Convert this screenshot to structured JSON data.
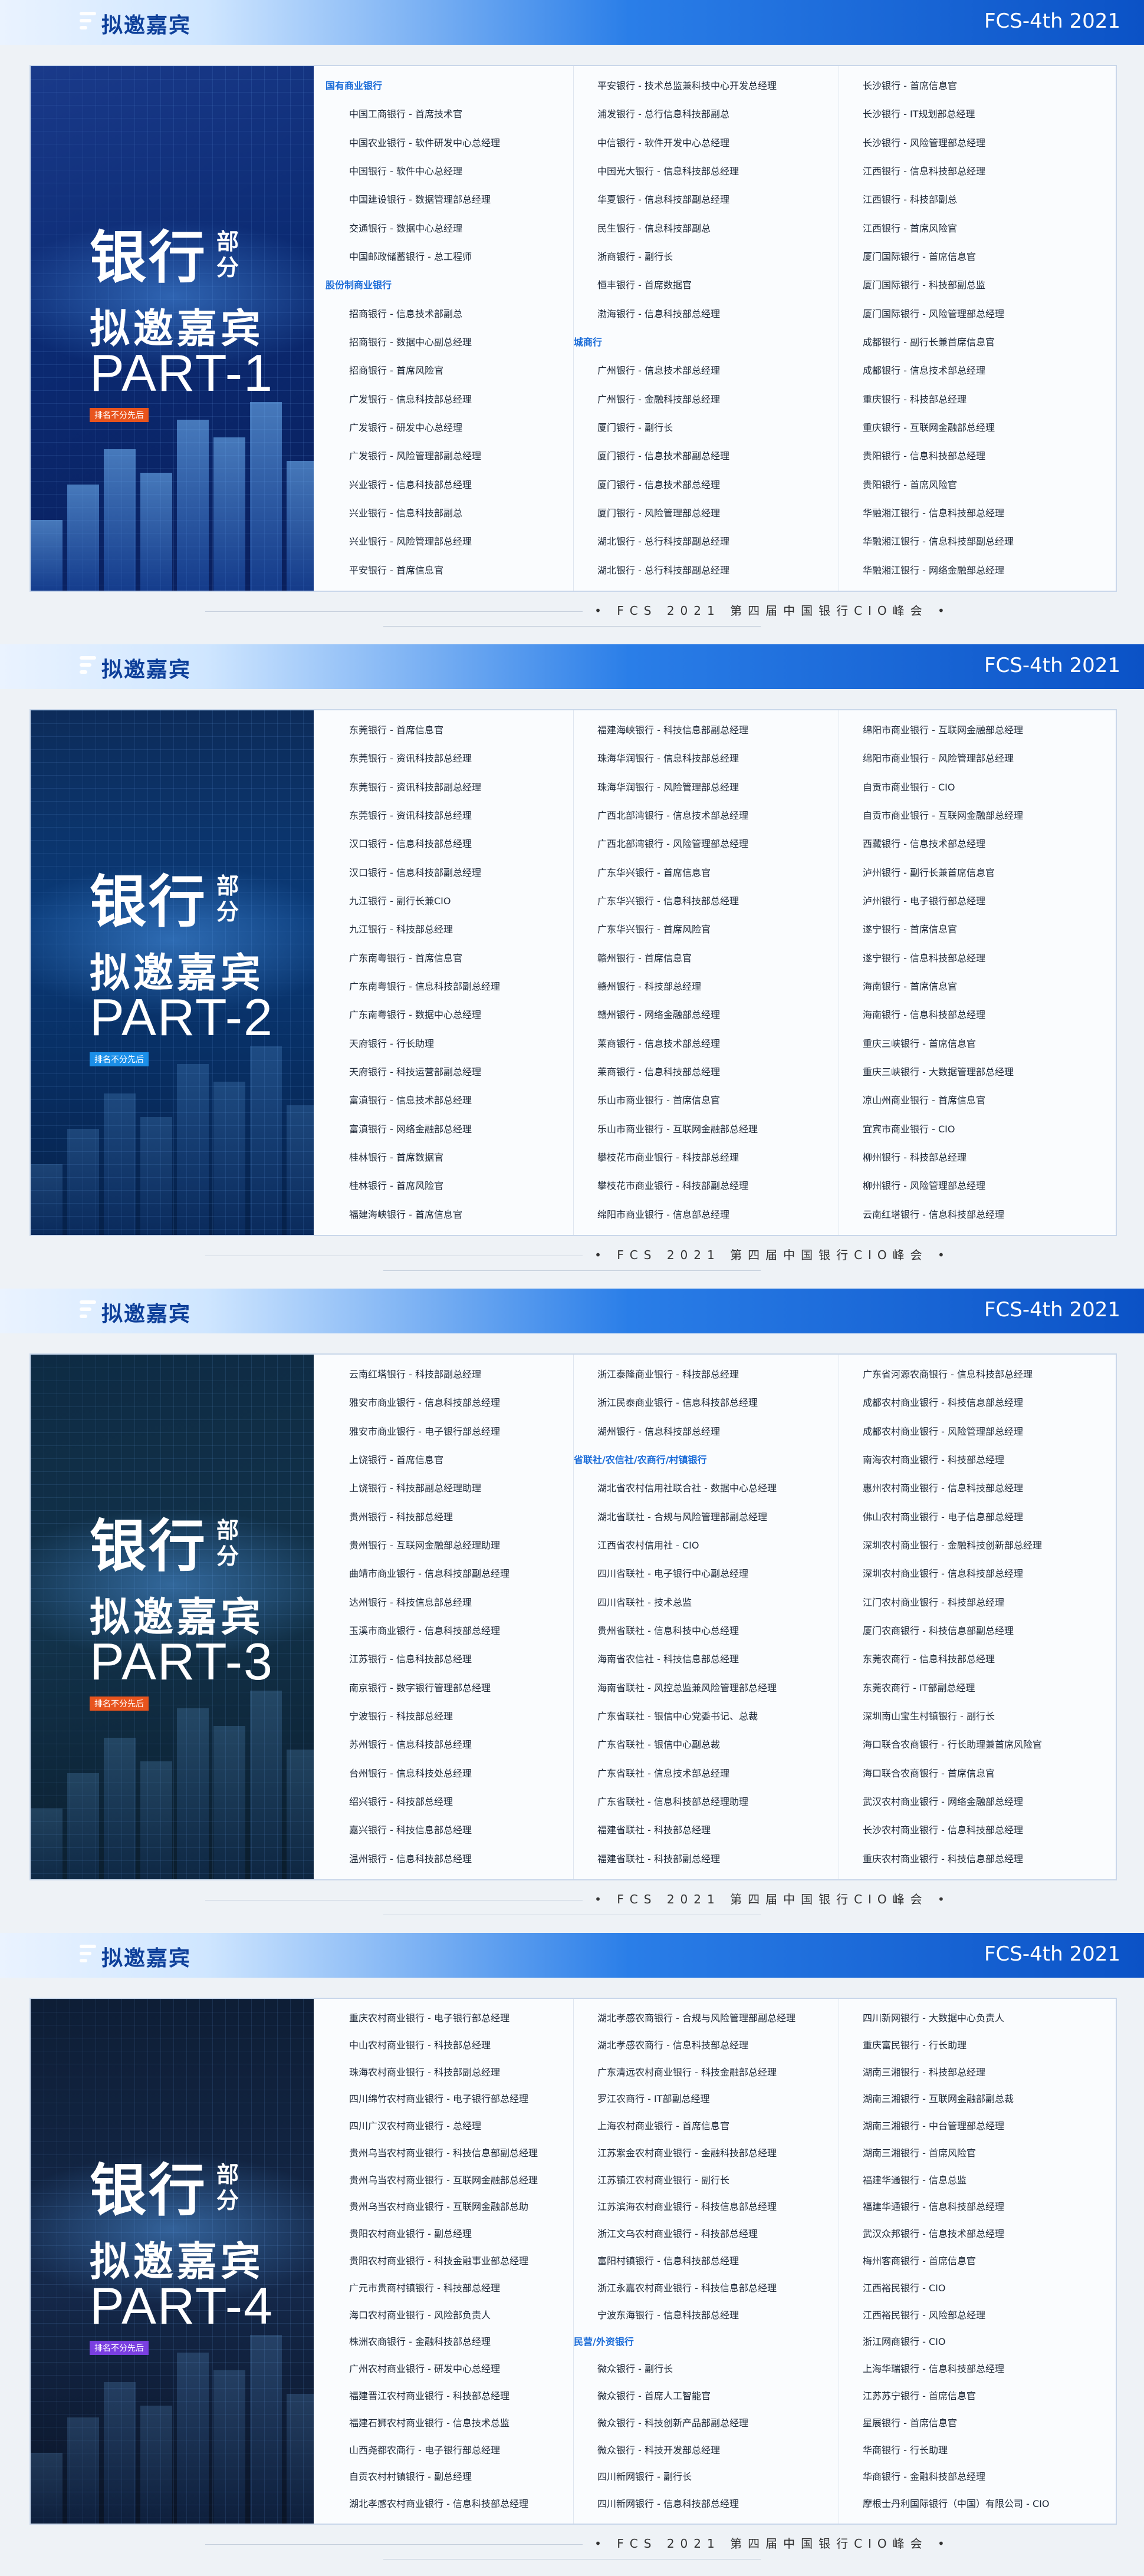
{
  "header": {
    "title": "拟邀嘉宾",
    "code": "FCS-4th 2021"
  },
  "footer": "• FCS 2021 第四届中国银行CIO峰会 •",
  "hero": {
    "big_line1": "银行",
    "small_line1a": "部",
    "small_line1b": "分",
    "big_line2": "拟邀嘉宾",
    "tag": "排名不分先后"
  },
  "sections": [
    {
      "part": "PART-1",
      "col1": [
        {
          "t": "国有商业银行",
          "c": true
        },
        {
          "t": "中国工商银行 - 首席技术官"
        },
        {
          "t": "中国农业银行 - 软件研发中心总经理"
        },
        {
          "t": "中国银行 - 软件中心总经理"
        },
        {
          "t": "中国建设银行 - 数据管理部总经理"
        },
        {
          "t": "交通银行 - 数据中心总经理"
        },
        {
          "t": "中国邮政储蓄银行 - 总工程师"
        },
        {
          "t": "股份制商业银行",
          "c": true
        },
        {
          "t": "招商银行 - 信息技术部副总"
        },
        {
          "t": "招商银行 - 数据中心副总经理"
        },
        {
          "t": "招商银行 - 首席风险官"
        },
        {
          "t": "广发银行 - 信息科技部总经理"
        },
        {
          "t": "广发银行 - 研发中心总经理"
        },
        {
          "t": "广发银行 - 风险管理部副总经理"
        },
        {
          "t": "兴业银行 - 信息科技部总经理"
        },
        {
          "t": "兴业银行 - 信息科技部副总"
        },
        {
          "t": "兴业银行 - 风险管理部总经理"
        },
        {
          "t": "平安银行 - 首席信息官"
        }
      ],
      "col2": [
        {
          "t": "平安银行 - 技术总监兼科技中心开发总经理"
        },
        {
          "t": "浦发银行 - 总行信息科技部副总"
        },
        {
          "t": "中信银行 - 软件开发中心总经理"
        },
        {
          "t": "中国光大银行 - 信息科技部总经理"
        },
        {
          "t": "华夏银行 - 信息科技部副总经理"
        },
        {
          "t": "民生银行 - 信息科技部副总"
        },
        {
          "t": "浙商银行 - 副行长"
        },
        {
          "t": "恒丰银行 - 首席数据官"
        },
        {
          "t": "渤海银行 - 信息科技部总经理"
        },
        {
          "t": "城商行",
          "c": true
        },
        {
          "t": "广州银行 - 信息技术部总经理"
        },
        {
          "t": "广州银行 - 金融科技部总经理"
        },
        {
          "t": "厦门银行 - 副行长"
        },
        {
          "t": "厦门银行 - 信息技术部副总经理"
        },
        {
          "t": "厦门银行 - 信息技术部总经理"
        },
        {
          "t": "厦门银行 - 风险管理部总经理"
        },
        {
          "t": "湖北银行 - 总行科技部副总经理"
        },
        {
          "t": "湖北银行 - 总行科技部副总经理"
        }
      ],
      "col3": [
        {
          "t": "长沙银行 - 首席信息官"
        },
        {
          "t": "长沙银行 - IT规划部总经理"
        },
        {
          "t": "长沙银行 - 风险管理部总经理"
        },
        {
          "t": "江西银行 - 信息科技部总经理"
        },
        {
          "t": "江西银行 - 科技部副总"
        },
        {
          "t": "江西银行 - 首席风险官"
        },
        {
          "t": "厦门国际银行 - 首席信息官"
        },
        {
          "t": "厦门国际银行 - 科技部副总监"
        },
        {
          "t": "厦门国际银行 - 风险管理部总经理"
        },
        {
          "t": "成都银行 - 副行长兼首席信息官"
        },
        {
          "t": "成都银行 - 信息技术部总经理"
        },
        {
          "t": "重庆银行 - 科技部总经理"
        },
        {
          "t": "重庆银行 - 互联网金融部总经理"
        },
        {
          "t": "贵阳银行 - 信息科技部总经理"
        },
        {
          "t": "贵阳银行 - 首席风险官"
        },
        {
          "t": "华融湘江银行 - 信息科技部总经理"
        },
        {
          "t": "华融湘江银行 - 信息科技部副总经理"
        },
        {
          "t": "华融湘江银行 - 网络金融部总经理"
        }
      ]
    },
    {
      "part": "PART-2",
      "col1": [
        {
          "t": "东莞银行 - 首席信息官"
        },
        {
          "t": "东莞银行 - 资讯科技部总经理"
        },
        {
          "t": "东莞银行 - 资讯科技部副总经理"
        },
        {
          "t": "东莞银行 - 资讯科技部总经理"
        },
        {
          "t": "汉口银行 - 信息科技部总经理"
        },
        {
          "t": "汉口银行 - 信息科技部副总经理"
        },
        {
          "t": "九江银行 - 副行长兼CIO"
        },
        {
          "t": "九江银行 - 科技部总经理"
        },
        {
          "t": "广东南粤银行 - 首席信息官"
        },
        {
          "t": "广东南粤银行 - 信息科技部副总经理"
        },
        {
          "t": "广东南粤银行 - 数据中心总经理"
        },
        {
          "t": "天府银行 - 行长助理"
        },
        {
          "t": "天府银行 - 科技运营部副总经理"
        },
        {
          "t": "富滇银行 - 信息技术部总经理"
        },
        {
          "t": "富滇银行 - 网络金融部总经理"
        },
        {
          "t": "桂林银行 - 首席数据官"
        },
        {
          "t": "桂林银行 - 首席风险官"
        },
        {
          "t": "福建海峡银行 - 首席信息官"
        }
      ],
      "col2": [
        {
          "t": "福建海峡银行 - 科技信息部副总经理"
        },
        {
          "t": "珠海华润银行 - 信息科技部总经理"
        },
        {
          "t": "珠海华润银行 - 风险管理部总经理"
        },
        {
          "t": "广西北部湾银行 - 信息技术部总经理"
        },
        {
          "t": "广西北部湾银行 - 风险管理部总经理"
        },
        {
          "t": "广东华兴银行 - 首席信息官"
        },
        {
          "t": "广东华兴银行 - 信息科技部总经理"
        },
        {
          "t": "广东华兴银行 - 首席风险官"
        },
        {
          "t": "赣州银行 - 首席信息官"
        },
        {
          "t": "赣州银行 - 科技部总经理"
        },
        {
          "t": "赣州银行 - 网络金融部总经理"
        },
        {
          "t": "莱商银行 - 信息技术部总经理"
        },
        {
          "t": "莱商银行 - 信息科技部总经理"
        },
        {
          "t": "乐山市商业银行 - 首席信息官"
        },
        {
          "t": "乐山市商业银行 - 互联网金融部总经理"
        },
        {
          "t": "攀枝花市商业银行 - 科技部总经理"
        },
        {
          "t": "攀枝花市商业银行 - 科技部副总经理"
        },
        {
          "t": "绵阳市商业银行 - 信息部总经理"
        }
      ],
      "col3": [
        {
          "t": "绵阳市商业银行 - 互联网金融部总经理"
        },
        {
          "t": "绵阳市商业银行 - 风险管理部总经理"
        },
        {
          "t": "自贡市商业银行 - CIO"
        },
        {
          "t": "自贡市商业银行 - 互联网金融部总经理"
        },
        {
          "t": "西藏银行 - 信息技术部总经理"
        },
        {
          "t": "泸州银行 - 副行长兼首席信息官"
        },
        {
          "t": "泸州银行 - 电子银行部总经理"
        },
        {
          "t": "遂宁银行 - 首席信息官"
        },
        {
          "t": "遂宁银行 - 信息科技部总经理"
        },
        {
          "t": "海南银行 - 首席信息官"
        },
        {
          "t": "海南银行 - 信息科技部总经理"
        },
        {
          "t": "重庆三峡银行 - 首席信息官"
        },
        {
          "t": "重庆三峡银行 - 大数据管理部总经理"
        },
        {
          "t": "凉山州商业银行 - 首席信息官"
        },
        {
          "t": "宜宾市商业银行 - CIO"
        },
        {
          "t": "柳州银行 - 科技部总经理"
        },
        {
          "t": "柳州银行 - 风险管理部总经理"
        },
        {
          "t": "云南红塔银行 - 信息科技部总经理"
        }
      ]
    },
    {
      "part": "PART-3",
      "col1": [
        {
          "t": "云南红塔银行 - 科技部副总经理"
        },
        {
          "t": "雅安市商业银行 - 信息科技部总经理"
        },
        {
          "t": "雅安市商业银行 - 电子银行部总经理"
        },
        {
          "t": "上饶银行 - 首席信息官"
        },
        {
          "t": "上饶银行 - 科技部副总经理助理"
        },
        {
          "t": "贵州银行 - 科技部总经理"
        },
        {
          "t": "贵州银行 - 互联网金融部总经理助理"
        },
        {
          "t": "曲靖市商业银行 - 信息科技部副总经理"
        },
        {
          "t": "达州银行 - 科技信息部总经理"
        },
        {
          "t": "玉溪市商业银行 - 信息科技部总经理"
        },
        {
          "t": "江苏银行 - 信息科技部总经理"
        },
        {
          "t": "南京银行 - 数字银行管理部总经理"
        },
        {
          "t": "宁波银行 - 科技部总经理"
        },
        {
          "t": "苏州银行 - 信息科技部总经理"
        },
        {
          "t": "台州银行 - 信息科技处总经理"
        },
        {
          "t": "绍兴银行 - 科技部总经理"
        },
        {
          "t": "嘉兴银行 - 科技信息部总经理"
        },
        {
          "t": "温州银行 - 信息科技部总经理"
        }
      ],
      "col2": [
        {
          "t": "浙江泰隆商业银行 - 科技部总经理"
        },
        {
          "t": "浙江民泰商业银行 - 信息科技部总经理"
        },
        {
          "t": "湖州银行 - 信息科技部总经理"
        },
        {
          "t": "省联社/农信社/农商行/村镇银行",
          "c": true
        },
        {
          "t": "湖北省农村信用社联合社 - 数据中心总经理"
        },
        {
          "t": "湖北省联社 - 合规与风险管理部副总经理"
        },
        {
          "t": "江西省农村信用社 - CIO"
        },
        {
          "t": "四川省联社 - 电子银行中心副总经理"
        },
        {
          "t": "四川省联社 - 技术总监"
        },
        {
          "t": "贵州省联社 - 信息科技中心总经理"
        },
        {
          "t": "海南省农信社 - 科技信息部总经理"
        },
        {
          "t": "海南省联社 - 风控总监兼风险管理部总经理"
        },
        {
          "t": "广东省联社 - 银信中心党委书记、总裁"
        },
        {
          "t": "广东省联社 - 银信中心副总裁"
        },
        {
          "t": "广东省联社 - 信息技术部总经理"
        },
        {
          "t": "广东省联社 - 信息科技部总经理助理"
        },
        {
          "t": "福建省联社 - 科技部总经理"
        },
        {
          "t": "福建省联社 - 科技部副总经理"
        }
      ],
      "col3": [
        {
          "t": "广东省河源农商银行 - 信息科技部总经理"
        },
        {
          "t": "成都农村商业银行 - 科技信息部总经理"
        },
        {
          "t": "成都农村商业银行 - 风险管理部总经理"
        },
        {
          "t": "南海农村商业银行 - 科技部总经理"
        },
        {
          "t": "惠州农村商业银行 - 信息科技部总经理"
        },
        {
          "t": "佛山农村商业银行 - 电子信息部总经理"
        },
        {
          "t": "深圳农村商业银行 - 金融科技创新部总经理"
        },
        {
          "t": "深圳农村商业银行 - 信息科技部总经理"
        },
        {
          "t": "江门农村商业银行 - 科技部总经理"
        },
        {
          "t": "厦门农商银行 - 科技信息部副总经理"
        },
        {
          "t": "东莞农商行 - 信息科技部总经理"
        },
        {
          "t": "东莞农商行 - IT部副总经理"
        },
        {
          "t": "深圳南山宝生村镇银行 - 副行长"
        },
        {
          "t": "海口联合农商银行 - 行长助理兼首席风险官"
        },
        {
          "t": "海口联合农商银行 - 首席信息官"
        },
        {
          "t": "武汉农村商业银行 - 网络金融部总经理"
        },
        {
          "t": "长沙农村商业银行 - 信息科技部总经理"
        },
        {
          "t": "重庆农村商业银行 - 科技信息部总经理"
        }
      ]
    },
    {
      "part": "PART-4",
      "col1": [
        {
          "t": "重庆农村商业银行 - 电子银行部总经理"
        },
        {
          "t": "中山农村商业银行 - 科技部总经理"
        },
        {
          "t": "珠海农村商业银行 - 科技部副总经理"
        },
        {
          "t": "四川绵竹农村商业银行 - 电子银行部总经理"
        },
        {
          "t": "四川广汉农村商业银行 - 总经理"
        },
        {
          "t": "贵州乌当农村商业银行 - 科技信息部副总经理"
        },
        {
          "t": "贵州乌当农村商业银行 - 互联网金融部总经理"
        },
        {
          "t": "贵州乌当农村商业银行 - 互联网金融部总助"
        },
        {
          "t": "贵阳农村商业银行 - 副总经理"
        },
        {
          "t": "贵阳农村商业银行 - 科技金融事业部总经理"
        },
        {
          "t": "广元市贵商村镇银行 - 科技部总经理"
        },
        {
          "t": "海口农村商业银行 - 风险部负责人"
        },
        {
          "t": "株洲农商银行 - 金融科技部总经理"
        },
        {
          "t": "广州农村商业银行 - 研发中心总经理"
        },
        {
          "t": "福建晋江农村商业银行 - 科技部总经理"
        },
        {
          "t": "福建石狮农村商业银行 - 信息技术总监"
        },
        {
          "t": "山西尧都农商行 - 电子银行部总经理"
        },
        {
          "t": "自贡农村村镇银行 - 副总经理"
        },
        {
          "t": "湖北孝感农村商业银行 - 信息科技部总经理"
        }
      ],
      "col2": [
        {
          "t": "湖北孝感农商银行 - 合规与风险管理部副总经理"
        },
        {
          "t": "湖北孝感农商行 - 信息科技部总经理"
        },
        {
          "t": "广东清远农村商业银行 - 科技金融部总经理"
        },
        {
          "t": "罗江农商行 - IT部副总经理"
        },
        {
          "t": "上海农村商业银行 - 首席信息官"
        },
        {
          "t": "江苏紫金农村商业银行 - 金融科技部总经理"
        },
        {
          "t": "江苏镇江农村商业银行 - 副行长"
        },
        {
          "t": "江苏滨海农村商业银行 - 科技信息部总经理"
        },
        {
          "t": "浙江文乌农村商业银行 - 科技部总经理"
        },
        {
          "t": "富阳村镇银行 - 信息科技部总经理"
        },
        {
          "t": "浙江永嘉农村商业银行 - 科技信息部总经理"
        },
        {
          "t": "宁波东海银行 - 信息科技部总经理"
        },
        {
          "t": "民营/外资银行",
          "c": true
        },
        {
          "t": "微众银行 - 副行长"
        },
        {
          "t": "微众银行 - 首席人工智能官"
        },
        {
          "t": "微众银行 - 科技创新产品部副总经理"
        },
        {
          "t": "微众银行 - 科技开发部总经理"
        },
        {
          "t": "四川新网银行 - 副行长"
        },
        {
          "t": "四川新网银行 - 信息科技部总经理"
        }
      ],
      "col3": [
        {
          "t": "四川新网银行 - 大数据中心负责人"
        },
        {
          "t": "重庆富民银行 - 行长助理"
        },
        {
          "t": "湖南三湘银行 - 科技部总经理"
        },
        {
          "t": "湖南三湘银行 - 互联网金融部副总裁"
        },
        {
          "t": "湖南三湘银行 - 中台管理部总经理"
        },
        {
          "t": "湖南三湘银行 - 首席风险官"
        },
        {
          "t": "福建华通银行 - 信息总监"
        },
        {
          "t": "福建华通银行 - 信息科技部总经理"
        },
        {
          "t": "武汉众邦银行 - 信息技术部总经理"
        },
        {
          "t": "梅州客商银行 - 首席信息官"
        },
        {
          "t": "江西裕民银行 - CIO"
        },
        {
          "t": "江西裕民银行 - 风险部总经理"
        },
        {
          "t": "浙江网商银行 - CIO"
        },
        {
          "t": "上海华瑞银行 - 信息科技部总经理"
        },
        {
          "t": "江苏苏宁银行 - 首席信息官"
        },
        {
          "t": "星展银行 - 首席信息官"
        },
        {
          "t": "华商银行 - 行长助理"
        },
        {
          "t": "华商银行 - 金融科技部总经理"
        },
        {
          "t": "摩根士丹利国际银行（中国）有限公司 - CIO"
        }
      ]
    }
  ],
  "colors": {
    "accent": "#1b6cd8",
    "header_blue": "#0b52c6"
  }
}
